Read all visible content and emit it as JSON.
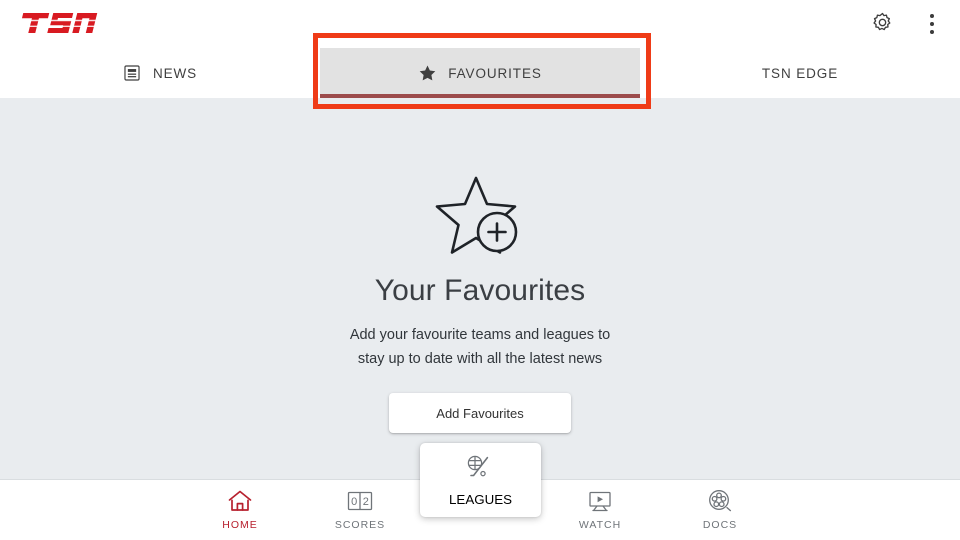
{
  "app": {
    "brand": "TSN",
    "brand_color": "#d81a21",
    "accent_red": "#b7202e",
    "annotation_color": "#ef3b17",
    "tab_underline_color": "#9c4b4b",
    "content_bg": "#e9ecef"
  },
  "header": {
    "logo_text": "TSN",
    "settings_icon": "gear-icon",
    "overflow_icon": "kebab-menu-icon"
  },
  "tabs": [
    {
      "label": "NEWS",
      "icon": "news-article-icon",
      "active": false
    },
    {
      "label": "FAVOURITES",
      "icon": "star-filled-icon",
      "active": true
    },
    {
      "label": "TSN EDGE",
      "icon": "",
      "active": false
    }
  ],
  "main": {
    "illustration_icon": "star-add-icon",
    "headline": "Your Favourites",
    "subtext": "Add your favourite teams and leagues to stay up to date with all the latest news",
    "cta_label": "Add Favourites"
  },
  "bottom_nav": [
    {
      "label": "HOME",
      "icon": "home-icon",
      "active": true
    },
    {
      "label": "SCORES",
      "icon": "scoreboard-icon",
      "active": false,
      "score_left": "0",
      "score_right": "2"
    },
    {
      "label": "LEAGUES",
      "icon": "leagues-icon",
      "active": false,
      "raised": true
    },
    {
      "label": "WATCH",
      "icon": "watch-tv-play-icon",
      "active": false
    },
    {
      "label": "DOCS",
      "icon": "film-reel-icon",
      "active": false
    }
  ]
}
